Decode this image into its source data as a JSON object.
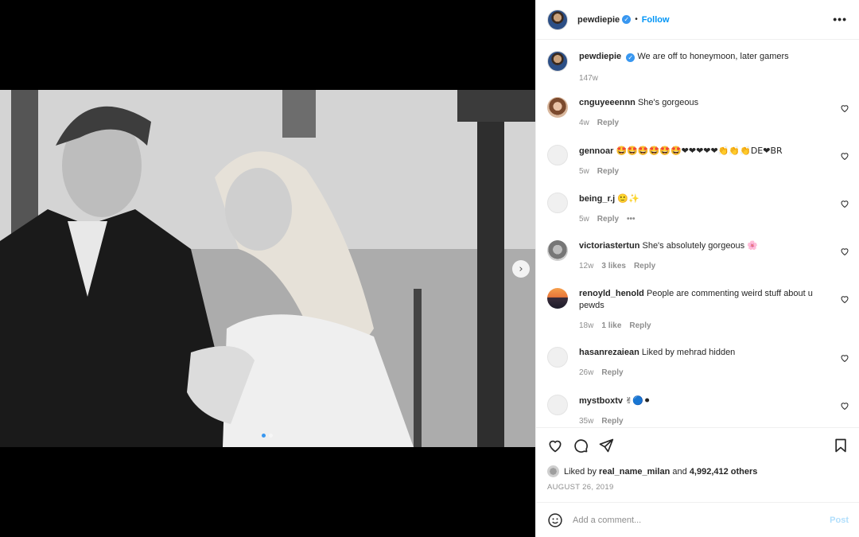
{
  "post": {
    "username": "pewdiepie",
    "verified_glyph": "✓",
    "separator": "•",
    "follow_label": "Follow",
    "more_label": "•••",
    "caption": "We are off to honeymoon, later gamers",
    "caption_age": "147w"
  },
  "media": {
    "next_glyph": "›",
    "slide_count": 2,
    "active_slide": 1
  },
  "comments": [
    {
      "user": "cnguyeeennn",
      "text": "She's gorgeous",
      "age": "4w",
      "likes": "",
      "reply": "Reply",
      "avatar": "girl"
    },
    {
      "user": "gennoar",
      "text": "🤩🤩🤩🤩🤩🤩❤❤❤❤❤👏👏👏DE❤BR",
      "age": "5w",
      "likes": "",
      "reply": "Reply",
      "avatar": "grey"
    },
    {
      "user": "being_r.j",
      "text": "🙂✨",
      "age": "5w",
      "likes": "",
      "reply": "Reply",
      "more": "•••",
      "avatar": "grey"
    },
    {
      "user": "victoriastertun",
      "text": "She's absolutely gorgeous 🌸",
      "age": "12w",
      "likes": "3 likes",
      "reply": "Reply",
      "avatar": "victoria"
    },
    {
      "user": "renoyld_henold",
      "text": "People are commenting weird stuff about u pewds",
      "age": "18w",
      "likes": "1 like",
      "reply": "Reply",
      "avatar": "renoyld"
    },
    {
      "user": "hasanrezaiean",
      "text": "Liked by mehrad hidden",
      "age": "26w",
      "likes": "",
      "reply": "Reply",
      "avatar": "grey"
    },
    {
      "user": "mystboxtv",
      "text": "✌🔵⚫",
      "age": "35w",
      "likes": "",
      "reply": "Reply",
      "avatar": "grey"
    }
  ],
  "likes": {
    "prefix": "Liked by",
    "first_user": "real_name_milan",
    "connector": "and",
    "others": "4,992,412 others"
  },
  "date": "AUGUST 26, 2019",
  "add_comment": {
    "placeholder": "Add a comment...",
    "post_label": "Post"
  },
  "colors": {
    "accent": "#0095f6",
    "verified": "#3897f0",
    "muted": "#8e8e8e",
    "post_disabled": "#b2dffc"
  }
}
